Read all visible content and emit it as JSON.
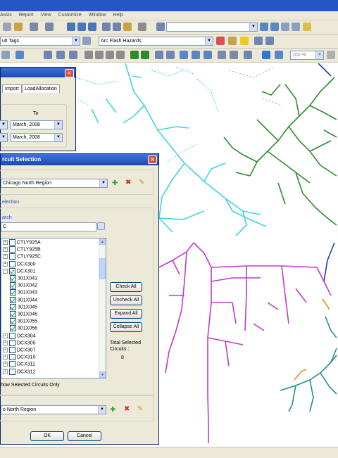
{
  "menu": [
    "Assis",
    "Report",
    "View",
    "Customize",
    "Window",
    "Help"
  ],
  "toolbar": {
    "tags_combo": "ult Tags",
    "layer_combo": "Arc Flash Hazards",
    "zoom_combo": "100 %",
    "address_combo": ""
  },
  "back_dialog": {
    "tabs": [
      "Import",
      "LoadAllocation"
    ],
    "to_label": "To",
    "to_date_1": "March, 2008",
    "to_date_2": "March, 2008"
  },
  "circuit_dialog": {
    "title": "rcuit Selection",
    "region_combo": "Chicago North Region",
    "section_label": "election",
    "search_label": "arch",
    "search_value": "C",
    "tree_items": [
      {
        "label": "CTLY925A",
        "checked": false,
        "expander": "+",
        "level": 0
      },
      {
        "label": "CTLY925B",
        "checked": false,
        "expander": "+",
        "level": 0
      },
      {
        "label": "CTLY925C",
        "checked": false,
        "expander": "+",
        "level": 0
      },
      {
        "label": "DCX300",
        "checked": false,
        "expander": "+",
        "level": 0
      },
      {
        "label": "DCX301",
        "checked": true,
        "expander": "-",
        "level": 0
      },
      {
        "label": "301X041",
        "checked": true,
        "expander": "",
        "level": 1
      },
      {
        "label": "301X042",
        "checked": true,
        "expander": "",
        "level": 1
      },
      {
        "label": "301X043",
        "checked": true,
        "expander": "",
        "level": 1
      },
      {
        "label": "301X044",
        "checked": true,
        "expander": "",
        "level": 1
      },
      {
        "label": "301X045",
        "checked": true,
        "expander": "",
        "level": 1
      },
      {
        "label": "301X046",
        "checked": true,
        "expander": "",
        "level": 1
      },
      {
        "label": "301X055",
        "checked": true,
        "expander": "",
        "level": 1
      },
      {
        "label": "301X056",
        "checked": true,
        "expander": "",
        "level": 1
      },
      {
        "label": "DCX304",
        "checked": false,
        "expander": "+",
        "level": 0
      },
      {
        "label": "DCX305",
        "checked": false,
        "expander": "+",
        "level": 0
      },
      {
        "label": "DCX307",
        "checked": false,
        "expander": "+",
        "level": 0
      },
      {
        "label": "DCX310",
        "checked": false,
        "expander": "+",
        "level": 0
      },
      {
        "label": "DCX311",
        "checked": false,
        "expander": "+",
        "level": 0
      },
      {
        "label": "DCX312",
        "checked": false,
        "expander": "+",
        "level": 0
      }
    ],
    "check_all": "Check All",
    "uncheck_all": "Uncheck All",
    "expand_all": "Expand All",
    "collapse_all": "Collapse All",
    "total_label_1": "Total Selected",
    "total_label_2": "Circuits :",
    "total_value": "8",
    "show_selected": "how Selected Circuits Only",
    "bottom_combo": "o North Region",
    "ok": "OK",
    "cancel": "Cancel"
  },
  "colors": {
    "cyan_feeder": "#3fd3e0",
    "green_feeder": "#2e8b2e",
    "magenta_feeder": "#c03bc8",
    "blue_feeder": "#1f3fa8",
    "teal_feeder": "#1f8f8f",
    "title_blue": "#2456c4"
  }
}
